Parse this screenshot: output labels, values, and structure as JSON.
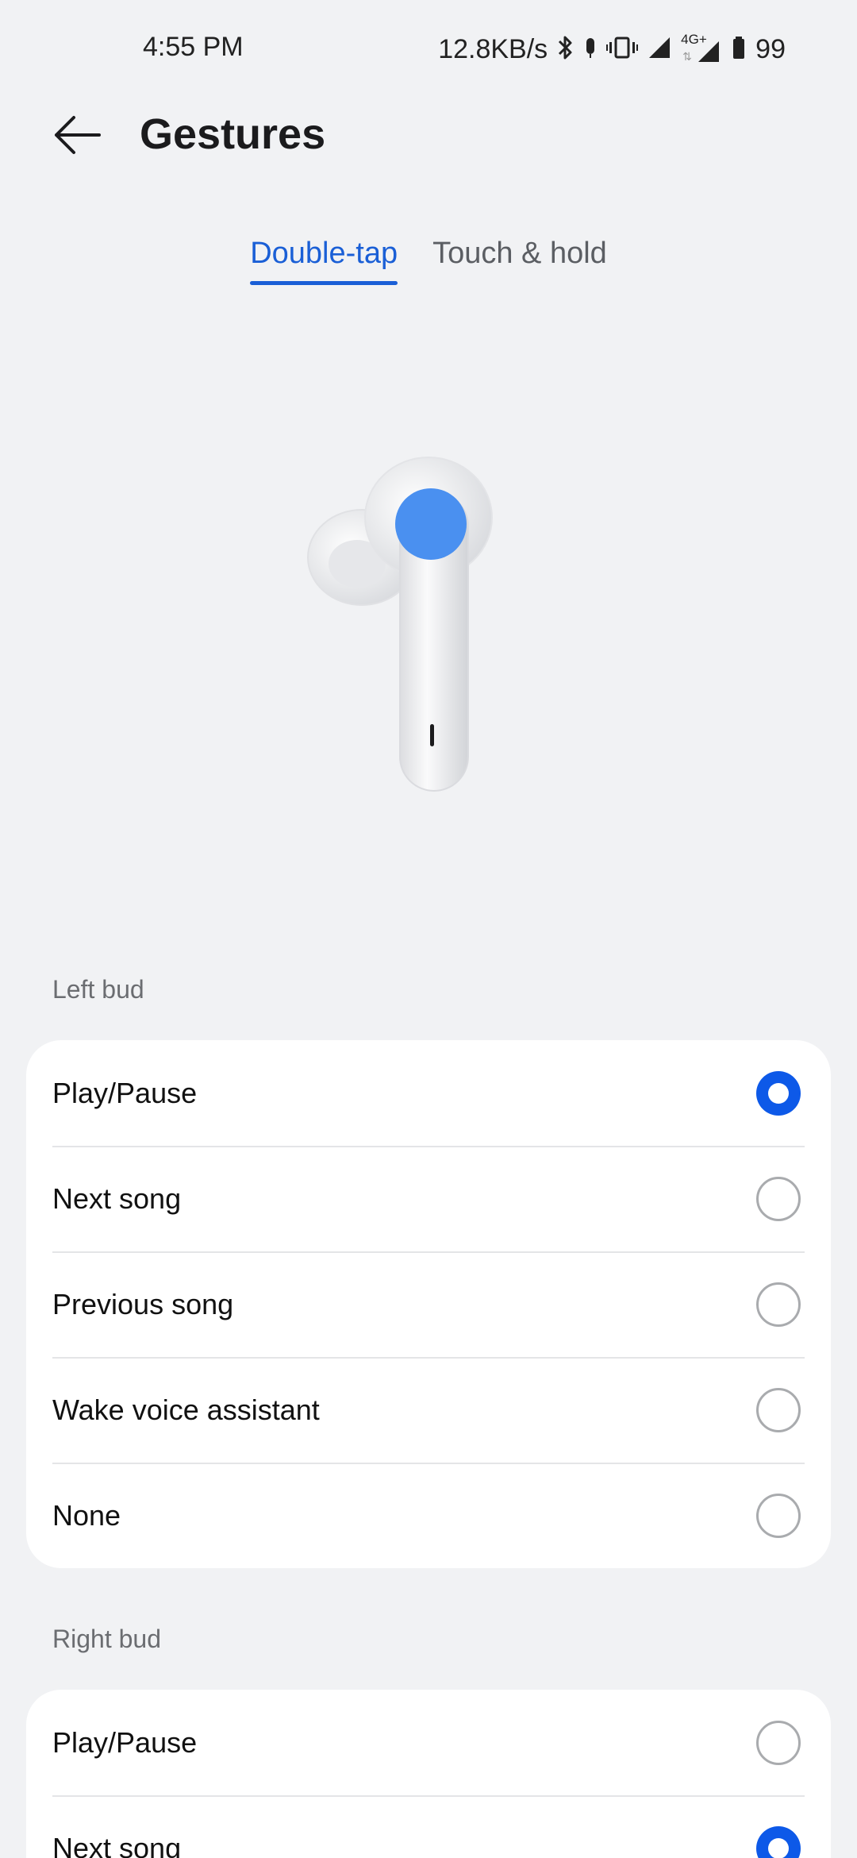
{
  "status_bar": {
    "time": "4:55 PM",
    "speed": "12.8KB/s",
    "network": "4G+",
    "battery": "99",
    "icons": [
      "bluetooth-icon",
      "mic-icon",
      "vibrate-icon",
      "signal-icon",
      "network-icon",
      "battery-icon"
    ]
  },
  "header": {
    "title": "Gestures",
    "back_icon": "arrow-left-icon"
  },
  "tabs": [
    {
      "label": "Double-tap",
      "active": true
    },
    {
      "label": "Touch & hold",
      "active": false
    }
  ],
  "illustration": {
    "icon": "earbud-icon",
    "highlight_color": "#4a90f0"
  },
  "left_bud": {
    "label": "Left bud",
    "options": [
      {
        "label": "Play/Pause",
        "selected": true
      },
      {
        "label": "Next song",
        "selected": false
      },
      {
        "label": "Previous song",
        "selected": false
      },
      {
        "label": "Wake voice assistant",
        "selected": false
      },
      {
        "label": "None",
        "selected": false
      }
    ]
  },
  "right_bud": {
    "label": "Right bud",
    "options": [
      {
        "label": "Play/Pause",
        "selected": false
      },
      {
        "label": "Next song",
        "selected": true
      }
    ]
  },
  "colors": {
    "accent": "#1a5fd6",
    "radio_checked": "#0d59e8",
    "background": "#f1f2f4"
  }
}
